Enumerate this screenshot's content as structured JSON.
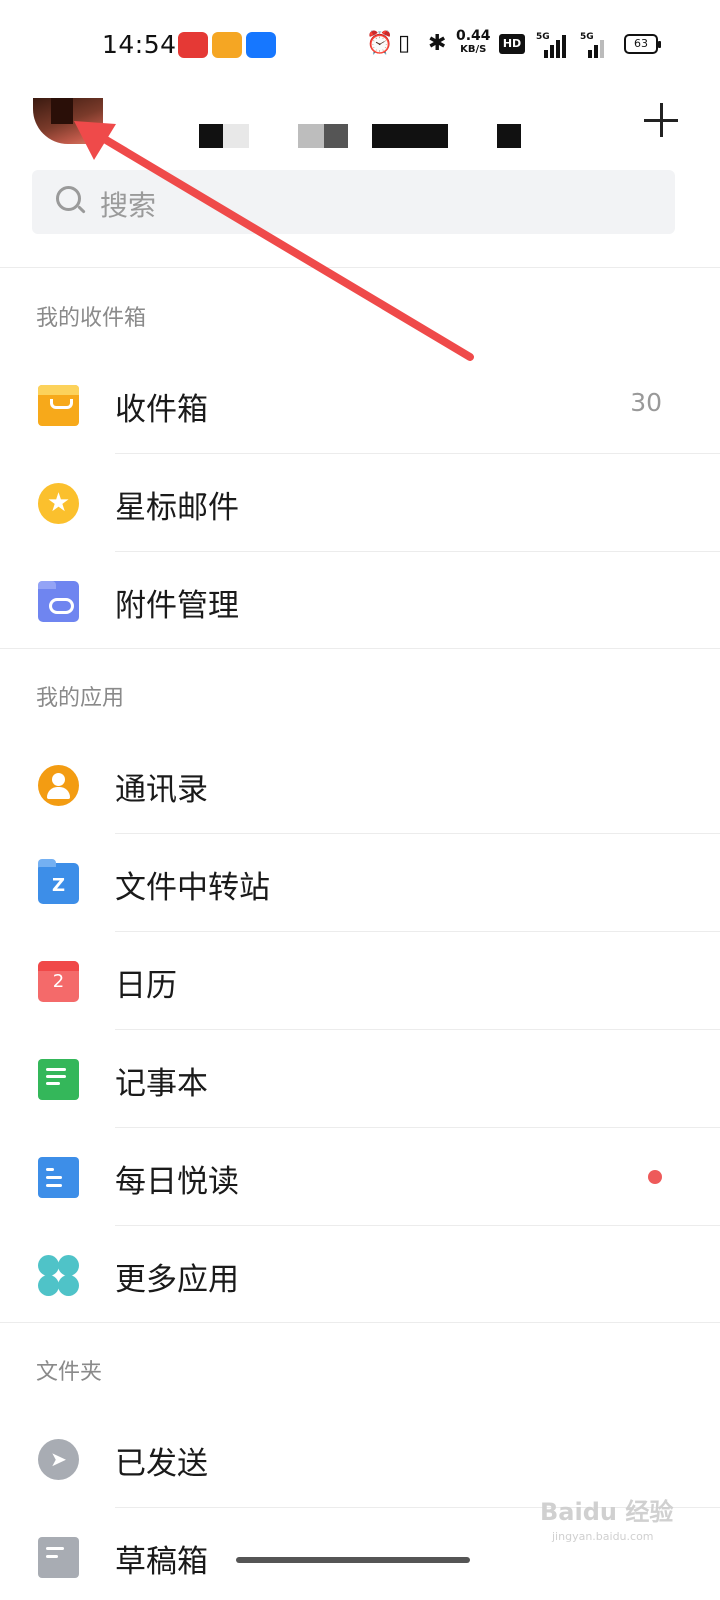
{
  "status_bar": {
    "time": "14:54",
    "net_speed": "0.44",
    "net_unit": "KB/S",
    "hd_label": "HD",
    "signal1_label": "5G",
    "signal2_label": "5G",
    "battery": "63",
    "icons": [
      "alarm-icon",
      "vibrate-icon",
      "bluetooth-icon"
    ]
  },
  "header": {
    "avatar": "avatar",
    "add_icon": "plus-icon"
  },
  "search": {
    "placeholder": "搜索"
  },
  "sections": {
    "mailbox_title": "我的收件箱",
    "apps_title": "我的应用",
    "folders_title": "文件夹"
  },
  "mailbox": {
    "inbox": {
      "label": "收件箱",
      "count": "30"
    },
    "starred": {
      "label": "星标邮件"
    },
    "attachments": {
      "label": "附件管理"
    }
  },
  "apps": {
    "contacts": {
      "label": "通讯录"
    },
    "file_transfer": {
      "label": "文件中转站",
      "icon_letter": "Z"
    },
    "calendar": {
      "label": "日历",
      "icon_day": "2"
    },
    "notes": {
      "label": "记事本"
    },
    "daily_read": {
      "label": "每日悦读"
    },
    "more_apps": {
      "label": "更多应用"
    }
  },
  "folders": {
    "sent": {
      "label": "已发送"
    },
    "drafts": {
      "label": "草稿箱"
    }
  },
  "watermark": {
    "main": "Baidu 经验",
    "sub": "jingyan.baidu.com"
  },
  "colors": {
    "annotation_arrow": "#ef4a4a",
    "unread_dot": "#ee5a5a"
  }
}
